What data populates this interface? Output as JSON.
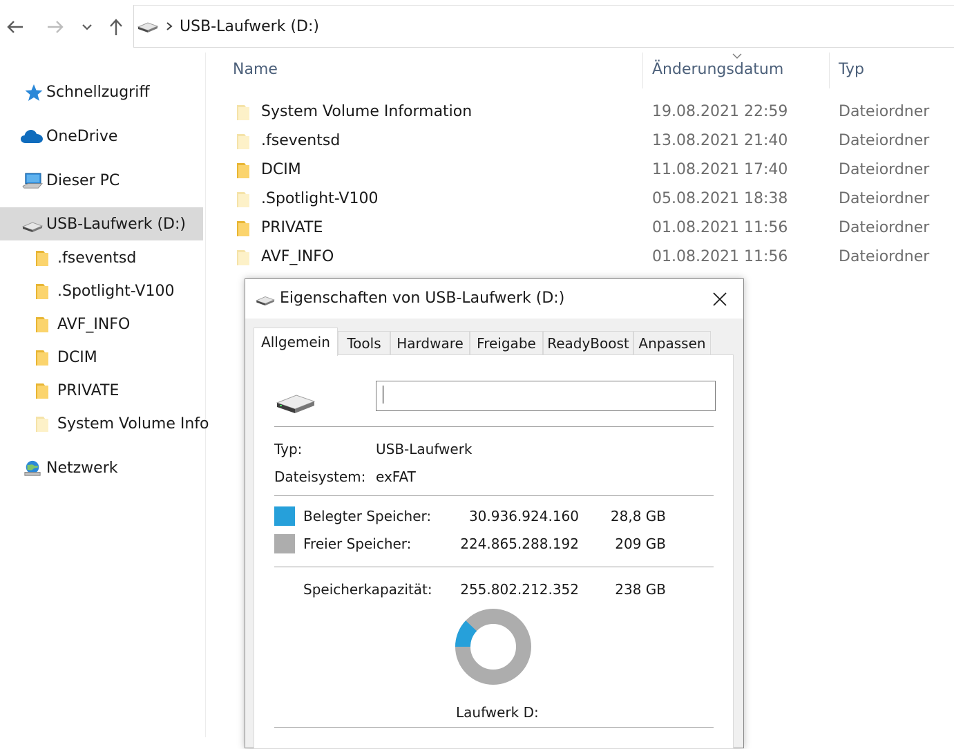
{
  "address_bar": {
    "path": "USB-Laufwerk (D:)"
  },
  "sidebar": {
    "items": [
      {
        "label": "Schnellzugriff",
        "icon": "star-icon"
      },
      {
        "label": "OneDrive",
        "icon": "cloud-icon"
      },
      {
        "label": "Dieser PC",
        "icon": "computer-icon"
      },
      {
        "label": "USB-Laufwerk (D:)",
        "icon": "drive-icon",
        "selected": true
      },
      {
        "label": ".fseventsd",
        "icon": "folder-icon"
      },
      {
        "label": ".Spotlight-V100",
        "icon": "folder-icon"
      },
      {
        "label": "AVF_INFO",
        "icon": "folder-icon"
      },
      {
        "label": "DCIM",
        "icon": "folder-icon"
      },
      {
        "label": "PRIVATE",
        "icon": "folder-icon"
      },
      {
        "label": "System Volume Info",
        "icon": "folder-icon"
      },
      {
        "label": "Netzwerk",
        "icon": "network-icon"
      }
    ]
  },
  "file_list": {
    "columns": {
      "name": "Name",
      "date": "Änderungsdatum",
      "type": "Typ"
    },
    "rows": [
      {
        "name": "System Volume Information",
        "date": "19.08.2021 22:59",
        "type": "Dateiordner"
      },
      {
        "name": ".fseventsd",
        "date": "13.08.2021 21:40",
        "type": "Dateiordner"
      },
      {
        "name": "DCIM",
        "date": "11.08.2021 17:40",
        "type": "Dateiordner"
      },
      {
        "name": ".Spotlight-V100",
        "date": "05.08.2021 18:38",
        "type": "Dateiordner"
      },
      {
        "name": "PRIVATE",
        "date": "01.08.2021 11:56",
        "type": "Dateiordner"
      },
      {
        "name": "AVF_INFO",
        "date": "01.08.2021 11:56",
        "type": "Dateiordner"
      }
    ]
  },
  "dialog": {
    "title": "Eigenschaften von USB-Laufwerk (D:)",
    "tabs": [
      "Allgemein",
      "Tools",
      "Hardware",
      "Freigabe",
      "ReadyBoost",
      "Anpassen"
    ],
    "active_tab": "Allgemein",
    "drive_name_value": "",
    "type_label": "Typ:",
    "type_value": "USB-Laufwerk",
    "fs_label": "Dateisystem:",
    "fs_value": "exFAT",
    "used_label": "Belegter Speicher:",
    "used_bytes": "30.936.924.160",
    "used_gb": "28,8 GB",
    "free_label": "Freier Speicher:",
    "free_bytes": "224.865.288.192",
    "free_gb": "209 GB",
    "capacity_label": "Speicherkapazität:",
    "capacity_bytes": "255.802.212.352",
    "capacity_gb": "238 GB",
    "drive_caption": "Laufwerk D:",
    "used_color": "#26a0da",
    "free_color": "#adadad",
    "used_fraction": 0.121
  }
}
